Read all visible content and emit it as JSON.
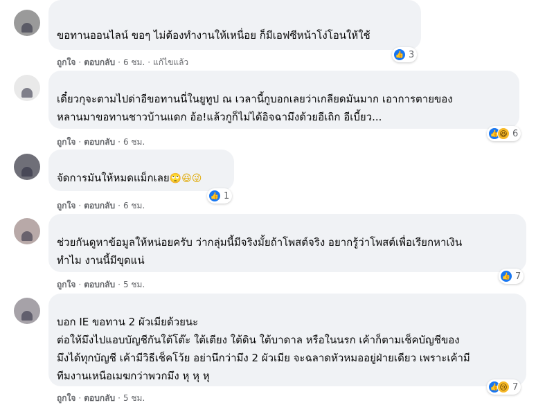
{
  "comments": [
    {
      "text": "ขอทานออนไลน์ ขอๆ ไม่ต้องทำงานให้เหนื่อย ก็มีเอฟซีหน้าโง่โอนให้ใช้",
      "actions": {
        "like": "ถูกใจ",
        "reply": "ตอบกลับ",
        "time": "6 ชม.",
        "edited": "แก้ไขแล้ว"
      },
      "reactions": {
        "count": "3",
        "icons": [
          "like-icon"
        ]
      }
    },
    {
      "text": "เดี๋ยวกุจะตามไปด่าอีขอทานนี่ในยูทูป ณ เวลานี้กูบอกเลยว่าเกลียดมันมาก เอาการตายของ\nหลานมาขอทานชาวบ้านแดก อ้อ!แล้วกูก็ไม่ได้อิจฉามึงด้วยอีเถิก อีเบี้ยว...",
      "actions": {
        "like": "ถูกใจ",
        "reply": "ตอบกลับ",
        "time": "6 ชม."
      },
      "reactions": {
        "count": "6",
        "icons": [
          "like-icon",
          "haha-icon"
        ]
      }
    },
    {
      "text": "จัดการมันให้หมดแม็กเลย",
      "emojis": "🙄😆😜",
      "actions": {
        "like": "ถูกใจ",
        "reply": "ตอบกลับ",
        "time": "6 ชม."
      },
      "reactions": {
        "count": "1",
        "icons": [
          "like-icon"
        ]
      }
    },
    {
      "text": "ช่วยกันดูหาข้อมูลให้หน่อยครับ ว่ากลุ่มนี้มีจริงมั้ยถ้าโพสต์จริง อยากรู้ว่าโพสต์เพื่อเรียกหาเงิน\nทำไม งานนี้มีขุดแน่",
      "actions": {
        "like": "ถูกใจ",
        "reply": "ตอบกลับ",
        "time": "5 ชม."
      },
      "reactions": {
        "count": "7",
        "icons": [
          "like-icon"
        ]
      }
    },
    {
      "text": "บอก IE ขอทาน 2 ผัวเมียด้วยนะ\nต่อให้มึงไปแอบบัญชีกันใต้โต๊ะ ใต้เตียง ใต้ดิน ใต้บาดาล หรือในนรก เค้าก็ตามเช็คบัญชีของ\nมึงได้ทุกบัญชี เค้ามีวิธีเช็คโว้ย อย่านึกว่ามึง 2 ผัวเมีย จะฉลาดหัวหมออยู่ฝ่ายเดียว เพราะเค้ามี\nทีมงานเหนือเมฆกว่าพวกมึง หุ หุ หุ",
      "actions": {
        "like": "ถูกใจ",
        "reply": "ตอบกลับ",
        "time": "5 ชม."
      },
      "reactions": {
        "count": "7",
        "icons": [
          "like-icon",
          "sad-icon"
        ]
      }
    }
  ]
}
